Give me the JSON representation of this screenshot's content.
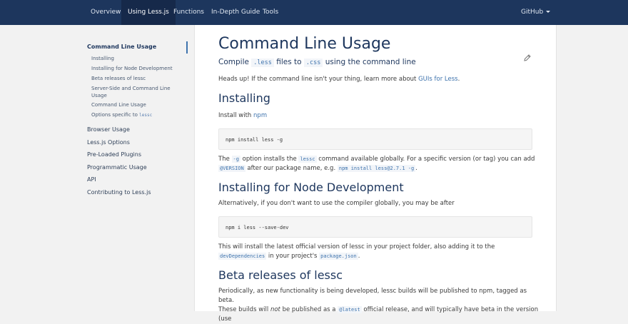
{
  "nav": {
    "items": [
      "Overview",
      "Using Less.js",
      "Functions",
      "In-Depth Guide",
      "Tools"
    ],
    "github": "GitHub"
  },
  "sidebar": {
    "title": "Command Line Usage",
    "subitems": [
      "Installing",
      "Installing for Node Development",
      "Beta releases of lessc",
      "Server-Side and Command Line Usage",
      "Command Line Usage",
      "Options specific to"
    ],
    "options_code": "lessc",
    "items": [
      "Browser Usage",
      "Less.js Options",
      "Pre-Loaded Plugins",
      "Programmatic Usage",
      "API",
      "Contributing to Less.js"
    ]
  },
  "main": {
    "title": "Command Line Usage",
    "lead": {
      "a": "Compile",
      "code1": ".less",
      "b": "files to",
      "code2": ".css",
      "c": "using the command line"
    },
    "headsup": {
      "text": "Heads up! If the command line isn't your thing, learn more about",
      "link": "GUIs for Less",
      "end": "."
    },
    "installing": {
      "heading": "Installing",
      "text": "Install with",
      "link": "npm",
      "code": "npm install less -g",
      "p": {
        "a": "The",
        "c1": "-g",
        "b": "option installs the",
        "c2": "lessc",
        "c": "command available globally. For a specific version (or tag) you can add",
        "c3": "@VERSION",
        "d": "after our package name, e.g.",
        "c4": "npm install less@2.7.1 -g",
        "e": "."
      }
    },
    "node": {
      "heading": "Installing for Node Development",
      "text": "Alternatively, if you don't want to use the compiler globally, you may be after",
      "code": "npm i less --save-dev",
      "p": {
        "a": "This will install the latest official version of lessc in your project folder, also adding it to the",
        "c1": "devDependencies",
        "b": "in your project's",
        "c2": "package.json",
        "c": "."
      }
    },
    "beta": {
      "heading": "Beta releases of lessc",
      "p1": "Periodically, as new functionality is being developed, lessc builds will be published to npm, tagged as beta.",
      "p2a": "These builds will",
      "p2em": "not",
      "p2b": "be published as a",
      "p2code": "@latest",
      "p2c": "official release, and will typically have beta in the version (use"
    }
  }
}
